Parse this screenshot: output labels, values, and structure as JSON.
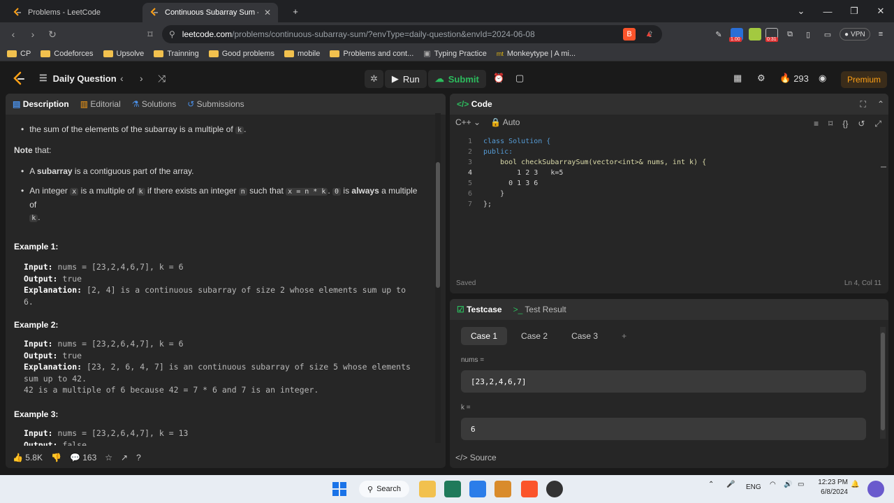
{
  "browser": {
    "tabs": [
      {
        "title": "Problems - LeetCode",
        "active": false
      },
      {
        "title": "Continuous Subarray Sum - Lee",
        "active": true
      }
    ],
    "url_host": "leetcode.com",
    "url_path": "/problems/continuous-subarray-sum/?envType=daily-question&envId=2024-06-08",
    "vpn_label": "VPN",
    "ext_badges": [
      "1.00",
      "0:31"
    ],
    "bookmarks": [
      "CP",
      "Codeforces",
      "Upsolve",
      "Trainning",
      "Good problems",
      "mobile",
      "Problems and cont...",
      "Typing Practice",
      "Monkeytype | A mi..."
    ]
  },
  "header": {
    "title": "Daily Question",
    "run": "Run",
    "submit": "Submit",
    "streak": "293",
    "premium": "Premium"
  },
  "left_tabs": [
    "Description",
    "Editorial",
    "Solutions",
    "Submissions"
  ],
  "description": {
    "bullet1": "the sum of the elements of the subarray is a multiple of",
    "bullet1_code": "k",
    "note_bold": "Note",
    "note_rest": " that:",
    "b2_pre": "A ",
    "b2_bold": "subarray",
    "b2_post": " is a contiguous part of the array.",
    "b3_1": "An integer ",
    "b3_x": "x",
    "b3_2": " is a multiple of ",
    "b3_k": "k",
    "b3_3": " if there exists an integer ",
    "b3_n": "n",
    "b3_4": " such that ",
    "b3_eq": "x = n * k",
    "b3_5": ". ",
    "b3_zero": "0",
    "b3_6": " is ",
    "b3_always": "always",
    "b3_7": " a multiple of",
    "b3_k2": "k",
    "b3_8": "."
  },
  "examples": [
    {
      "title": "Example 1:",
      "input": "nums = [23,2,4,6,7], k = 6",
      "output": "true",
      "explanation": "[2, 4] is a continuous subarray of size 2 whose elements sum up to",
      "exp2": "6."
    },
    {
      "title": "Example 2:",
      "input": "nums = [23,2,6,4,7], k = 6",
      "output": "true",
      "explanation": "[23, 2, 6, 4, 7] is an continuous subarray of size 5 whose elements",
      "exp2": "sum up to 42.",
      "exp3": "42 is a multiple of 6 because 42 = 7 * 6 and 7 is an integer."
    },
    {
      "title": "Example 3:",
      "input": "nums = [23,2,6,4,7], k = 13",
      "output": "false"
    }
  ],
  "labels": {
    "input": "Input:",
    "output": "Output:",
    "explanation": "Explanation:"
  },
  "footer": {
    "likes": "5.8K",
    "comments": "163"
  },
  "code_panel": {
    "title": "Code",
    "language": "C++",
    "mode": "Auto",
    "saved": "Saved",
    "cursor": "Ln 4, Col 11",
    "lines": [
      "class Solution {",
      "public:",
      "    bool checkSubarraySum(vector<int>& nums, int k) {",
      "        1 2 3   k=5",
      "      0 1 3 6",
      "    }",
      "};"
    ]
  },
  "testcase": {
    "tab1": "Testcase",
    "tab2": "Test Result",
    "cases": [
      "Case 1",
      "Case 2",
      "Case 3"
    ],
    "nums_label": "nums =",
    "nums_value": "[23,2,4,6,7]",
    "k_label": "k =",
    "k_value": "6",
    "source": "Source"
  },
  "taskbar": {
    "search": "Search",
    "lang": "ENG",
    "time": "12:23 PM",
    "date": "6/8/2024"
  }
}
